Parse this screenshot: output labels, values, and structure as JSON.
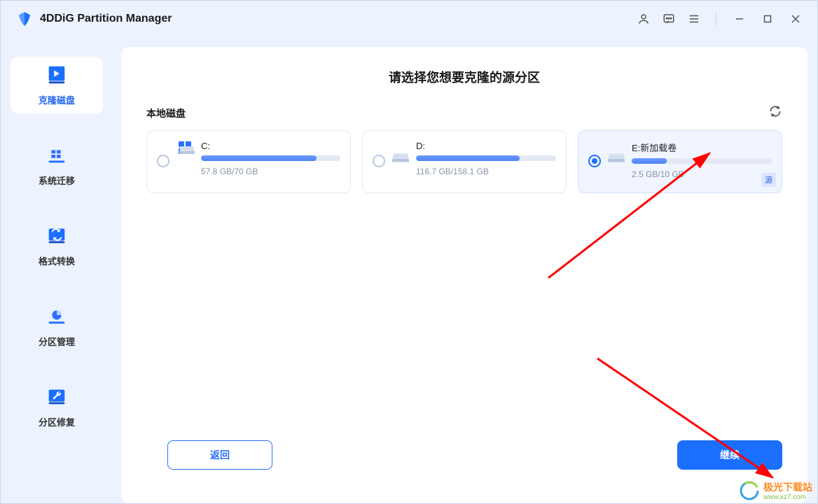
{
  "app": {
    "title": "4DDiG Partition Manager"
  },
  "sidebar": [
    {
      "label": "克隆磁盘",
      "active": true
    },
    {
      "label": "系统迁移",
      "active": false
    },
    {
      "label": "格式转换",
      "active": false
    },
    {
      "label": "分区管理",
      "active": false
    },
    {
      "label": "分区修复",
      "active": false
    }
  ],
  "main": {
    "heading": "请选择您想要克隆的源分区",
    "section_label": "本地磁盘",
    "back_label": "返回",
    "continue_label": "继续",
    "source_badge": "源"
  },
  "disks": [
    {
      "letter": "C:",
      "size_text": "57.8 GB/70 GB",
      "fill_pct": 83,
      "selected": false,
      "is_os": true
    },
    {
      "letter": "D:",
      "size_text": "116.7 GB/158.1 GB",
      "fill_pct": 74,
      "selected": false,
      "is_os": false
    },
    {
      "letter": "E:新加载卷",
      "size_text": "2.5 GB/10 GB",
      "fill_pct": 25,
      "selected": true,
      "is_os": false
    }
  ],
  "watermark": {
    "line1": "极光下载站",
    "line2": "www.xz7.com"
  }
}
